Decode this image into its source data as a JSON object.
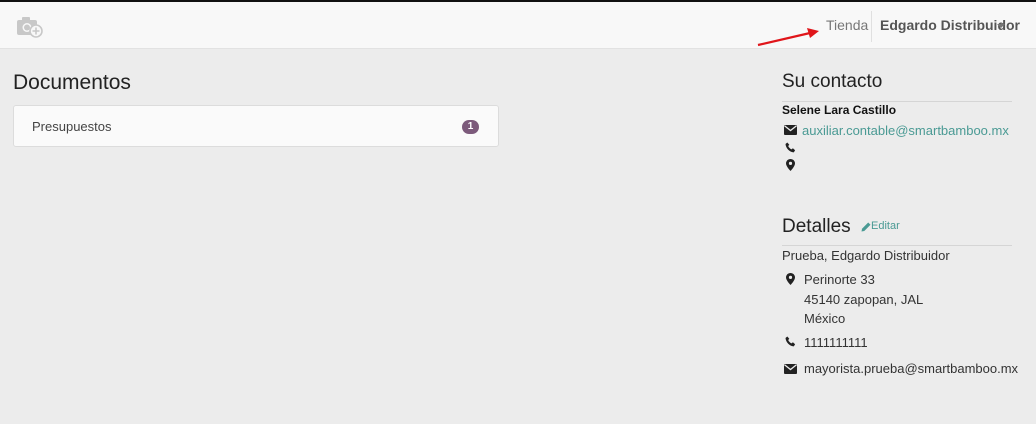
{
  "topbar": {
    "shop_label": "Tienda",
    "user_label": "Edgardo Distribuidor"
  },
  "documents": {
    "title": "Documentos",
    "items": [
      {
        "label": "Presupuestos",
        "count": "1"
      }
    ]
  },
  "contact": {
    "title": "Su contacto",
    "name": "Selene Lara Castillo",
    "email": "auxiliar.contable@smartbamboo.mx"
  },
  "details": {
    "title": "Detalles",
    "edit_label": "Editar",
    "company": "Prueba, Edgardo Distribuidor",
    "address_line1": "Perinorte 33",
    "address_line2": "45140 zapopan, JAL",
    "address_line3": "México",
    "phone": "1111111111",
    "email": "mayorista.prueba@smartbamboo.mx"
  },
  "colors": {
    "accent_link": "#4a9a94",
    "badge": "#7c5a7b",
    "annotation_arrow": "#e0151a"
  },
  "icons": [
    "camera-plus-icon",
    "envelope-icon",
    "phone-icon",
    "map-marker-icon",
    "pencil-icon",
    "caret-down-icon",
    "red-arrow-annotation"
  ]
}
